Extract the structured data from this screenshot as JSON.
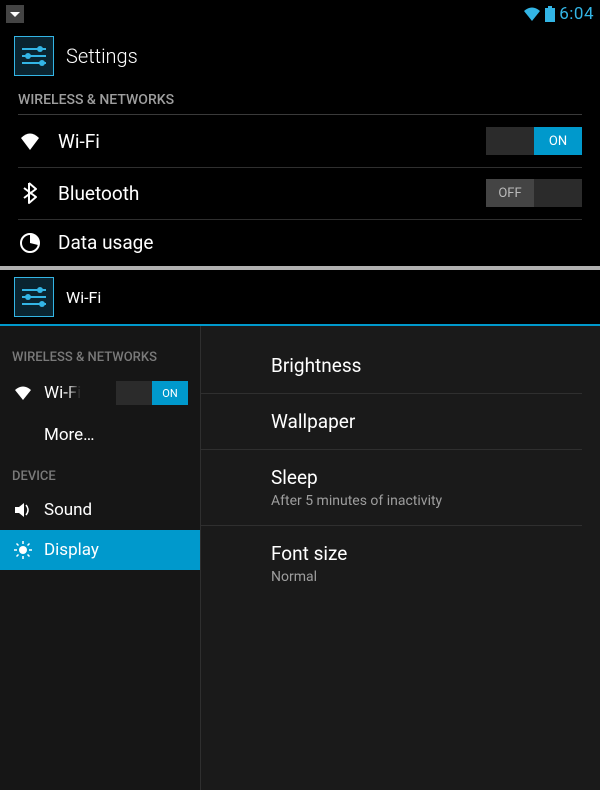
{
  "status_bar": {
    "time": "6:04"
  },
  "top": {
    "title": "Settings",
    "section1": "WIRELESS & NETWORKS",
    "items": {
      "wifi": {
        "label": "Wi-Fi",
        "toggle": "ON"
      },
      "bluetooth": {
        "label": "Bluetooth",
        "toggle": "OFF"
      },
      "data_usage": {
        "label": "Data usage"
      }
    }
  },
  "second": {
    "title": "Wi-Fi",
    "left": {
      "section1": "WIRELESS & NETWORKS",
      "wifi": {
        "label": "Wi-Fi",
        "toggle": "ON"
      },
      "more": {
        "label": "More…"
      },
      "section2": "DEVICE",
      "sound": {
        "label": "Sound"
      },
      "display": {
        "label": "Display"
      }
    },
    "right": {
      "brightness": {
        "label": "Brightness"
      },
      "wallpaper": {
        "label": "Wallpaper"
      },
      "sleep": {
        "label": "Sleep",
        "sub": "After 5 minutes of inactivity"
      },
      "font_size": {
        "label": "Font size",
        "sub": "Normal"
      }
    }
  }
}
